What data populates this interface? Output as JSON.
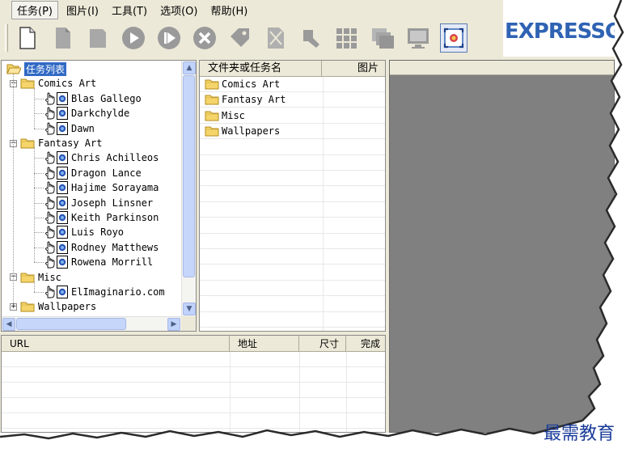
{
  "menu": {
    "items": [
      {
        "label": "任务(P)"
      },
      {
        "label": "图片(I)"
      },
      {
        "label": "工具(T)"
      },
      {
        "label": "选项(O)"
      },
      {
        "label": "帮助(H)"
      }
    ]
  },
  "toolbar": {
    "buttons": [
      {
        "icon": "new-task-icon"
      },
      {
        "icon": "open-task-icon"
      },
      {
        "icon": "save-task-icon"
      },
      {
        "icon": "start-icon"
      },
      {
        "icon": "skip-icon"
      },
      {
        "icon": "stop-icon"
      },
      {
        "icon": "tag-icon"
      },
      {
        "icon": "edit-icon"
      },
      {
        "icon": "tool-icon"
      },
      {
        "icon": "grid-view-icon"
      },
      {
        "icon": "cascade-view-icon"
      },
      {
        "icon": "monitor-icon"
      },
      {
        "icon": "preview-icon"
      }
    ]
  },
  "logo": {
    "text": "EXPRESSG"
  },
  "tree": {
    "root": "任务列表",
    "groups": [
      {
        "name": "Comics Art",
        "items": [
          "Blas Gallego",
          "Darkchylde",
          "Dawn"
        ]
      },
      {
        "name": "Fantasy Art",
        "items": [
          "Chris Achilleos",
          "Dragon Lance",
          "Hajime Sorayama",
          "Joseph Linsner",
          "Keith Parkinson",
          "Luis Royo",
          "Rodney Matthews",
          "Rowena Morrill"
        ]
      },
      {
        "name": "Misc",
        "items": [
          "ElImaginario.com"
        ]
      },
      {
        "name": "Wallpapers",
        "items": []
      }
    ]
  },
  "file_list": {
    "headers": {
      "name": "文件夹或任务名",
      "image": "图片"
    },
    "rows": [
      "Comics Art",
      "Fantasy Art",
      "Misc",
      "Wallpapers"
    ]
  },
  "url_list": {
    "headers": {
      "url": "URL",
      "address": "地址",
      "size": "尺寸",
      "done": "完成"
    }
  },
  "watermark": "最需教育",
  "colors": {
    "selection": "#316ac5",
    "window": "#ece9d8",
    "preview_bg": "#808080",
    "folder": "#f5d56b",
    "logo": "#2f63b3"
  }
}
